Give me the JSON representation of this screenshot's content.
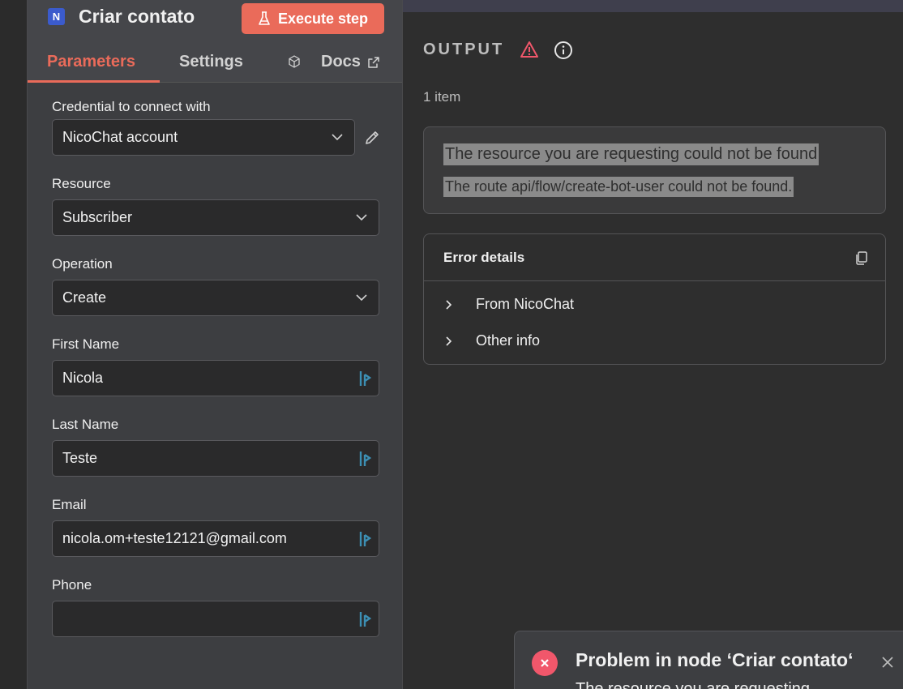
{
  "node": {
    "icon_letter": "N",
    "title": "Criar contato",
    "execute_label": "Execute step",
    "tabs": [
      {
        "label": "Parameters",
        "active": true
      },
      {
        "label": "Settings",
        "active": false
      }
    ],
    "docs_label": "Docs"
  },
  "fields": {
    "credential": {
      "label": "Credential to connect with",
      "value": "NicoChat account"
    },
    "resource": {
      "label": "Resource",
      "value": "Subscriber"
    },
    "operation": {
      "label": "Operation",
      "value": "Create"
    },
    "first_name": {
      "label": "First Name",
      "value": "Nicola"
    },
    "last_name": {
      "label": "Last Name",
      "value": "Teste"
    },
    "email": {
      "label": "Email",
      "value": "nicola.om+teste12121@gmail.com"
    },
    "phone": {
      "label": "Phone",
      "value": ""
    }
  },
  "output": {
    "title": "OUTPUT",
    "item_count": "1 item",
    "error_message": "The resource you are requesting could not be found",
    "error_description": "The route api/flow/create-bot-user could not be found.",
    "details_title": "Error details",
    "details_rows": [
      "From NicoChat",
      "Other info"
    ]
  },
  "toast": {
    "title": "Problem in node ‘Criar contato‘",
    "body": "The resource you are requesting"
  },
  "colors": {
    "accent": "#ea6b5a",
    "error": "#f1576b",
    "panel": "#3d3e41",
    "background": "#2e2e2e"
  }
}
